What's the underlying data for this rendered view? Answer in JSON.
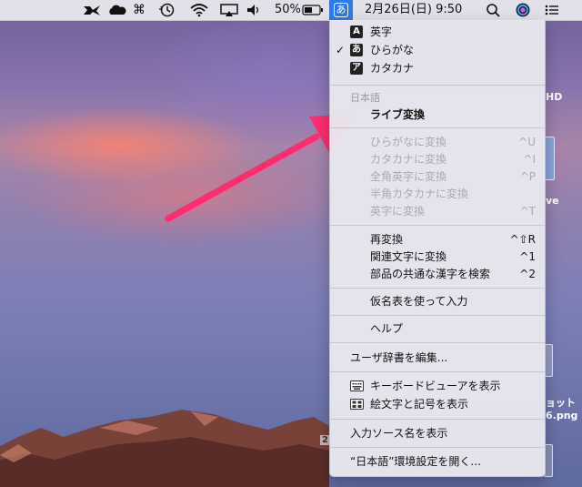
{
  "menubar": {
    "battery_percent": "50%",
    "input_mode_char": "あ",
    "datetime": "2月26日(日)  9:50"
  },
  "menu": {
    "input_sources": [
      {
        "badge": "A",
        "label": "英字",
        "checked": false
      },
      {
        "badge": "あ",
        "label": "ひらがな",
        "checked": true
      },
      {
        "badge": "ア",
        "label": "カタカナ",
        "checked": false
      }
    ],
    "section_header": "日本語",
    "live_conversion": "ライブ変換",
    "convert_items": [
      {
        "label": "ひらがなに変換",
        "shortcut": "^U"
      },
      {
        "label": "カタカナに変換",
        "shortcut": "^I"
      },
      {
        "label": "全角英字に変換",
        "shortcut": "^P"
      },
      {
        "label": "半角カタカナに変換",
        "shortcut": ""
      },
      {
        "label": "英字に変換",
        "shortcut": "^T"
      }
    ],
    "edit_items": [
      {
        "label": "再変換",
        "shortcut": "^⇧R"
      },
      {
        "label": "関連文字に変換",
        "shortcut": "^1"
      },
      {
        "label": "部品の共通な漢字を検索",
        "shortcut": "^2"
      }
    ],
    "kana_table": "仮名表を使って入力",
    "help": "ヘルプ",
    "edit_dictionary": "ユーザ辞書を編集...",
    "keyboard_viewer": "キーボードビューアを表示",
    "emoji_symbols": "絵文字と記号を表示",
    "show_source_name": "入力ソース名を表示",
    "open_prefs": "“日本語”環境設定を開く..."
  },
  "desktop": {
    "drive_label": "HD",
    "fragment_1": "ve",
    "fragment_2": "ョット",
    "fragment_3": "6.png",
    "fragment_4": "2"
  },
  "colors": {
    "accent": "#2f7be6",
    "arrow": "#ff2d6f"
  }
}
